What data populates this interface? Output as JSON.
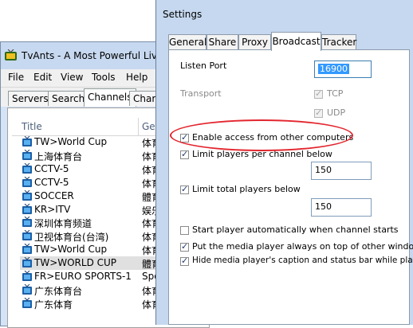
{
  "tvants": {
    "title": "TvAnts - A Most Powerful Live TV",
    "menu": [
      "File",
      "Edit",
      "View",
      "Tools",
      "Help"
    ],
    "tabs": [
      "Servers",
      "Search",
      "Channels",
      "Charts"
    ],
    "active_tab": "Channels",
    "columns": {
      "title": "Title",
      "genre": "Genre"
    },
    "rows": [
      {
        "title": "TW>World Cup",
        "genre": "体育"
      },
      {
        "title": "上海体育台",
        "genre": "体育"
      },
      {
        "title": "CCTV-5",
        "genre": "体育"
      },
      {
        "title": "CCTV-5",
        "genre": "体育"
      },
      {
        "title": "SOCCER",
        "genre": "體育"
      },
      {
        "title": "KR>ITV",
        "genre": "娱乐"
      },
      {
        "title": "深圳体育频道",
        "genre": "体育"
      },
      {
        "title": "卫视体育台(台湾)",
        "genre": "体育"
      },
      {
        "title": "TW>World Cup",
        "genre": "体育"
      },
      {
        "title": "TW>WORLD CUP",
        "genre": "體育"
      },
      {
        "title": "FR>EURO SPORTS-1",
        "genre": "Spo"
      },
      {
        "title": "广东体育台",
        "genre": "体育"
      },
      {
        "title": "广东体育",
        "genre": "体育"
      }
    ]
  },
  "settings": {
    "title": "Settings",
    "tabs": [
      "General",
      "Share",
      "Proxy",
      "Broadcast",
      "Tracker"
    ],
    "active_tab": "Broadcast",
    "listen_port_label": "Listen Port",
    "listen_port_value": "16900",
    "transport_label": "Transport",
    "tcp_label": "TCP",
    "udp_label": "UDP",
    "enable_access_label": "Enable access from other computers",
    "limit_players_channel_label": "Limit players per channel below",
    "limit_players_channel_value": "150",
    "limit_total_label": "Limit total players below",
    "limit_total_value": "150",
    "start_player_label": "Start player automatically when channel starts",
    "on_top_label": "Put the media player always on top of other windows",
    "hide_caption_label": "Hide media player's caption and status bar while playing",
    "checks": {
      "tcp": true,
      "udp": true,
      "enable_access": true,
      "limit_channel": true,
      "limit_total": true,
      "start_player": false,
      "on_top": true,
      "hide_caption": true
    }
  },
  "colors": {
    "annotation": "#e3262e",
    "selection": "#3399ff"
  }
}
